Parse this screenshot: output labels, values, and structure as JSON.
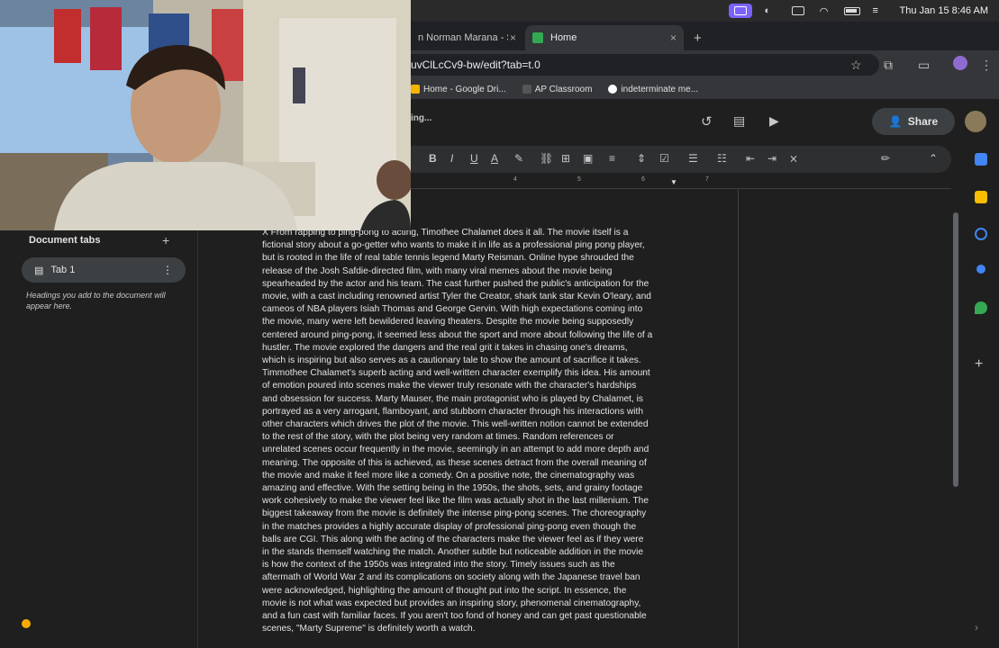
{
  "menubar": {
    "datetime": "Thu Jan 15  8:46 AM"
  },
  "tabs": [
    {
      "label": "n Norman Marana - STU"
    },
    {
      "label": "Home"
    }
  ],
  "tab_close": "×",
  "new_tab": "+",
  "address": {
    "url": "uvClLcCv9-bw/edit?tab=t.0"
  },
  "bookmarks": [
    {
      "label": "Home - Google Dri..."
    },
    {
      "label": "AP Classroom"
    },
    {
      "label": "indeterminate me..."
    }
  ],
  "docs_header": {
    "saving": "ing...",
    "share_label": "Share"
  },
  "format_toolbar": {
    "bold": "B",
    "italic": "I",
    "underline": "U",
    "text_color": "A"
  },
  "ruler": [
    "4",
    "5",
    "6",
    "7"
  ],
  "left_panel": {
    "title": "Document tabs",
    "add": "+",
    "tab_label": "Tab 1",
    "tab_more": "⋮",
    "hint": "Headings you add to the document will appear here."
  },
  "document": {
    "body": "X From rapping to ping-pong to acting, Timothee Chalamet does it all. The movie itself is a\nfictional story about a go-getter who wants to make it in life as a professional ping pong player,\nbut is rooted in the life of real table tennis legend Marty Reisman. Online hype shrouded the\nrelease of the Josh Safdie-directed film, with many viral memes about the movie being\nspearheaded by the actor and his team. The cast further pushed the public's anticipation for the\nmovie, with a cast including renowned artist Tyler the Creator, shark tank star Kevin O'leary, and\ncameos of NBA players Isiah Thomas and George Gervin. With high expectations coming into\nthe movie, many were left bewildered leaving theaters. Despite the movie being supposedly\ncentered around ping-pong, it seemed less about the sport and more about following the life of a\nhustler. The movie explored the dangers and the real grit it takes in chasing one's dreams,\nwhich is inspiring but also serves as a cautionary tale to show the amount of sacrifice it takes.\nTimmothee Chalamet's superb acting and well-written character exemplify this idea. His amount\nof emotion poured into scenes make the viewer truly resonate with the character's hardships\nand obsession for success. Marty Mauser, the main protagonist who is played by Chalamet, is\nportrayed as a very arrogant, flamboyant, and stubborn character through his interactions with\nother characters which drives the plot of the movie. This well-written notion cannot be extended\nto the rest of the story, with the plot being very random at times. Random references or\nunrelated scenes occur frequently in the movie, seemingly in an attempt to add more depth and\nmeaning. The opposite of this is achieved, as these scenes detract from the overall meaning of\nthe movie and make it feel more like a comedy. On a positive note, the cinematography was\namazing and effective. With the setting being in the 1950s, the shots, sets, and grainy footage\nwork cohesively to make the viewer feel like the film was actually shot in the last millenium. The\nbiggest takeaway from the movie is definitely the intense ping-pong scenes. The choreography\nin the matches provides a highly accurate display of professional ping-pong even though the\nballs are CGI. This along with the acting of the characters make the viewer feel as if they were\nin the stands themself watching the match. Another subtle but noticeable addition in the movie\nis how the context of the 1950s was integrated into the story. Timely issues such as the\naftermath of World War 2 and its complications on society along with the Japanese travel ban\nwere acknowledged, highlighting the amount of thought put into the script. In essence, the\nmovie is not what was expected but provides an inspiring story, phenomenal cinematography,\nand a fun cast with familiar faces. If you aren't too fond of honey and can get past questionable\nscenes, \"Marty Supreme\" is definitely worth a watch."
  },
  "colors": {
    "accent_record": "#7b61ff",
    "sheets_green": "#34a853"
  }
}
